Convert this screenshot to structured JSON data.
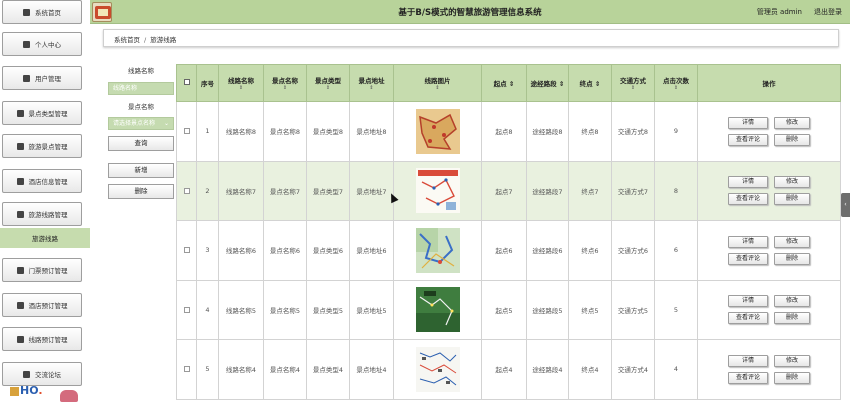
{
  "app": {
    "title": "基于B/S模式的智慧旅游管理信息系统",
    "user": "管理员 admin",
    "logout": "退出登录"
  },
  "sidebar": {
    "items": [
      {
        "label": "系统首页",
        "icon": "home-icon"
      },
      {
        "label": "个人中心",
        "icon": "user-icon"
      },
      {
        "label": "用户管理",
        "icon": "sliders-icon"
      },
      {
        "label": "景点类型管理",
        "icon": "monitor-icon"
      },
      {
        "label": "旅游景点管理",
        "icon": "car-icon"
      },
      {
        "label": "酒店信息管理",
        "icon": "monitor-icon"
      },
      {
        "label": "旅游线路管理",
        "icon": "bar-chart-icon"
      },
      {
        "label": "门票预订管理",
        "icon": "grid-icon"
      },
      {
        "label": "酒店预订管理",
        "icon": "grid-icon"
      },
      {
        "label": "线路预订管理",
        "icon": "grid-icon"
      },
      {
        "label": "交流论坛",
        "icon": "chat-icon"
      }
    ],
    "active_label": "旅游线路"
  },
  "breadcrumb": {
    "home": "系统首页",
    "separator": "/",
    "current": "旅游线路"
  },
  "search": {
    "route_label": "线路名称",
    "route_placeholder": "线路名称",
    "spot_label": "景点名称",
    "spot_placeholder": "请选择景点名称",
    "query_button": "查询",
    "add_button": "新增",
    "delete_button": "删除"
  },
  "table": {
    "columns": [
      "序号",
      "线路名称",
      "景点名称",
      "景点类型",
      "景点地址",
      "线路图片",
      "起点",
      "途经路段",
      "终点",
      "交通方式",
      "点击次数",
      "操作"
    ],
    "sort_glyph": "⇕",
    "op_labels": {
      "detail": "详情",
      "edit": "修改",
      "reviews": "查看评论",
      "delete": "删除"
    },
    "rows": [
      {
        "idx": "1",
        "route": "线路名称8",
        "spot": "景点名称8",
        "type": "景点类型8",
        "addr": "景点地址8",
        "start": "起点8",
        "via": "途经路段8",
        "end": "终点8",
        "transport": "交通方式8",
        "clicks": "9"
      },
      {
        "idx": "2",
        "route": "线路名称7",
        "spot": "景点名称7",
        "type": "景点类型7",
        "addr": "景点地址7",
        "start": "起点7",
        "via": "途经路段7",
        "end": "终点7",
        "transport": "交通方式7",
        "clicks": "8"
      },
      {
        "idx": "3",
        "route": "线路名称6",
        "spot": "景点名称6",
        "type": "景点类型6",
        "addr": "景点地址6",
        "start": "起点6",
        "via": "途经路段6",
        "end": "终点6",
        "transport": "交通方式6",
        "clicks": "6"
      },
      {
        "idx": "4",
        "route": "线路名称5",
        "spot": "景点名称5",
        "type": "景点类型5",
        "addr": "景点地址5",
        "start": "起点5",
        "via": "途经路段5",
        "end": "终点5",
        "transport": "交通方式5",
        "clicks": "5"
      },
      {
        "idx": "5",
        "route": "线路名称4",
        "spot": "景点名称4",
        "type": "景点类型4",
        "addr": "景点地址4",
        "start": "起点4",
        "via": "途经路段4",
        "end": "终点4",
        "transport": "交通方式4",
        "clicks": "4"
      }
    ]
  },
  "colors": {
    "accent": "#c6dcae",
    "topbar": "#b8d39a",
    "highlight_row": "#e9f1df"
  }
}
